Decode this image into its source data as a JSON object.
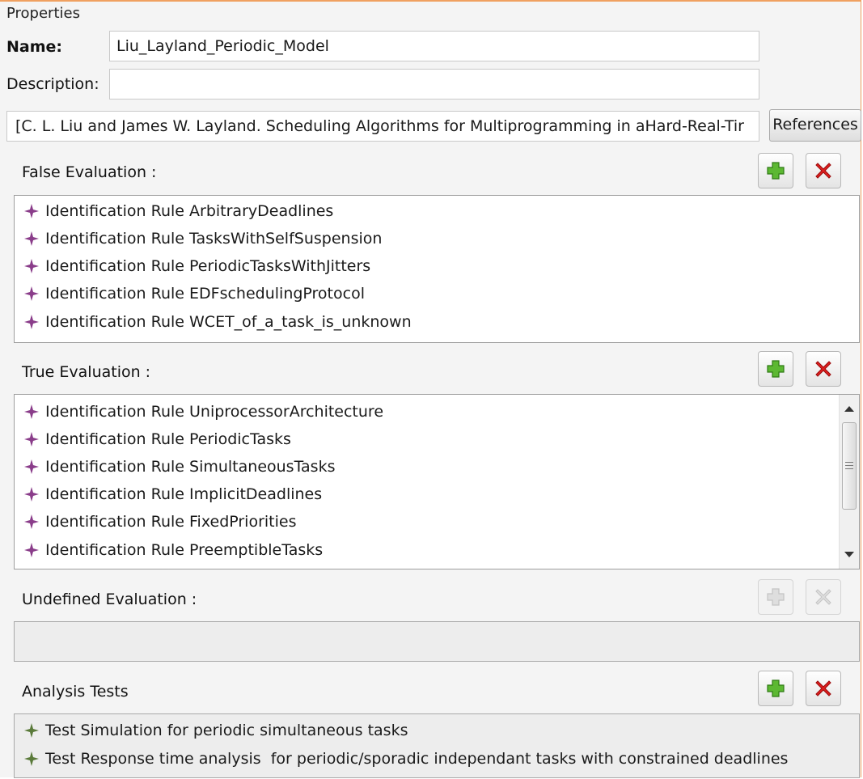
{
  "window": {
    "title": "Properties"
  },
  "name_field": {
    "label": "Name:",
    "value": "Liu_Layland_Periodic_Model"
  },
  "description_field": {
    "label": "Description:",
    "value": ""
  },
  "reference_field": {
    "value": "[C. L. Liu and James W. Layland. Scheduling Algorithms for Multiprogramming in aHard-Real-Tir",
    "button_label": "References"
  },
  "false_evaluation": {
    "label": "False Evaluation :",
    "items": [
      "Identification Rule ArbitraryDeadlines",
      "Identification Rule TasksWithSelfSuspension",
      "Identification Rule PeriodicTasksWithJitters",
      "Identification Rule EDFschedulingProtocol",
      "Identification Rule WCET_of_a_task_is_unknown"
    ]
  },
  "true_evaluation": {
    "label": "True Evaluation :",
    "items": [
      "Identification Rule UniprocessorArchitecture",
      "Identification Rule PeriodicTasks",
      "Identification Rule SimultaneousTasks",
      "Identification Rule ImplicitDeadlines",
      "Identification Rule FixedPriorities",
      "Identification Rule PreemptibleTasks"
    ]
  },
  "undefined_evaluation": {
    "label": "Undefined Evaluation :",
    "items": []
  },
  "analysis_tests": {
    "label": "Analysis Tests",
    "items": [
      "Test Simulation for periodic simultaneous tasks",
      "Test Response time analysis  for periodic/sporadic independant tasks with constrained deadlines"
    ]
  },
  "colors": {
    "rule_icon": "#8a3d8a",
    "test_icon": "#5a7a3a",
    "add_icon": "#5cb832",
    "remove_icon": "#e02020",
    "window_border": "#f0a060"
  },
  "icons": {
    "rule": "purple-star-icon",
    "test": "green-star-icon",
    "add": "green-plus-icon",
    "remove": "red-x-icon"
  }
}
